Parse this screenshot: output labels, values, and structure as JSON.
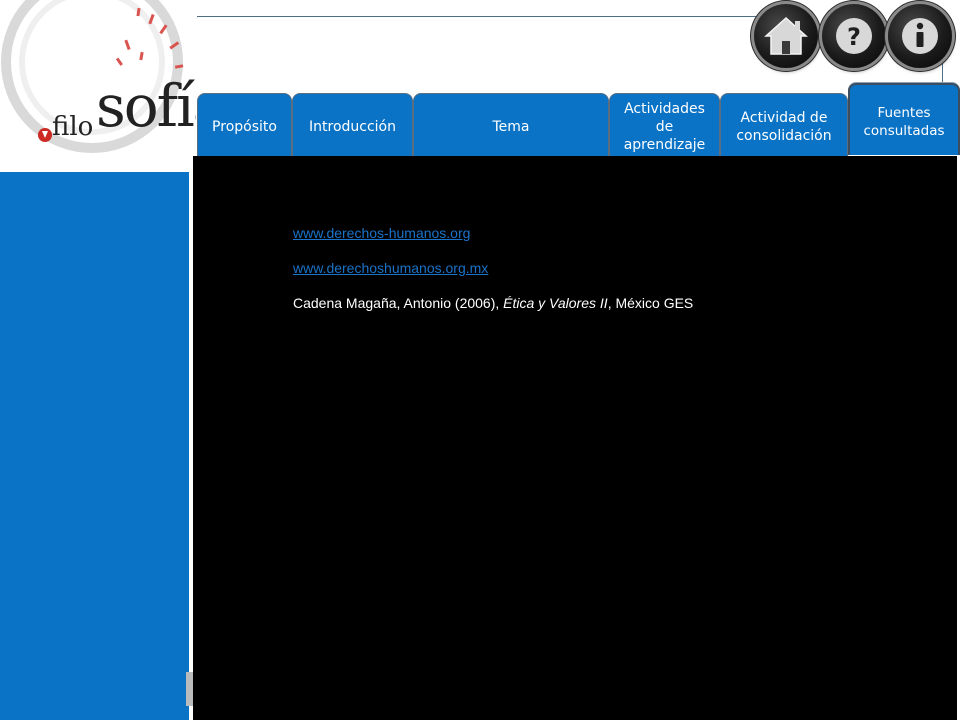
{
  "logo": {
    "prefix": "filo",
    "main": "sofía"
  },
  "icons": {
    "home": "home-icon",
    "help": "question-icon",
    "info": "info-icon"
  },
  "tabs": [
    {
      "label": "Propósito"
    },
    {
      "label": "Introducción"
    },
    {
      "label": "Tema"
    },
    {
      "label": "Actividades de aprendizaje"
    },
    {
      "label": "Actividad de consolidación"
    },
    {
      "label": "Fuentes consultadas",
      "active": true
    }
  ],
  "references": {
    "link1": "www.derechos-humanos.org",
    "link2": "www.derechoshumanos.org.mx",
    "citation_author": "Cadena Magaña, Antonio (2006), ",
    "citation_title": "Ética y Valores II",
    "citation_rest": ", México GES"
  },
  "colors": {
    "tab_blue": "#0a73c6",
    "sidebar_blue": "#0a73c6",
    "content_bg": "#000000",
    "link_blue": "#1a73c9",
    "logo_red": "#cc2a23"
  }
}
